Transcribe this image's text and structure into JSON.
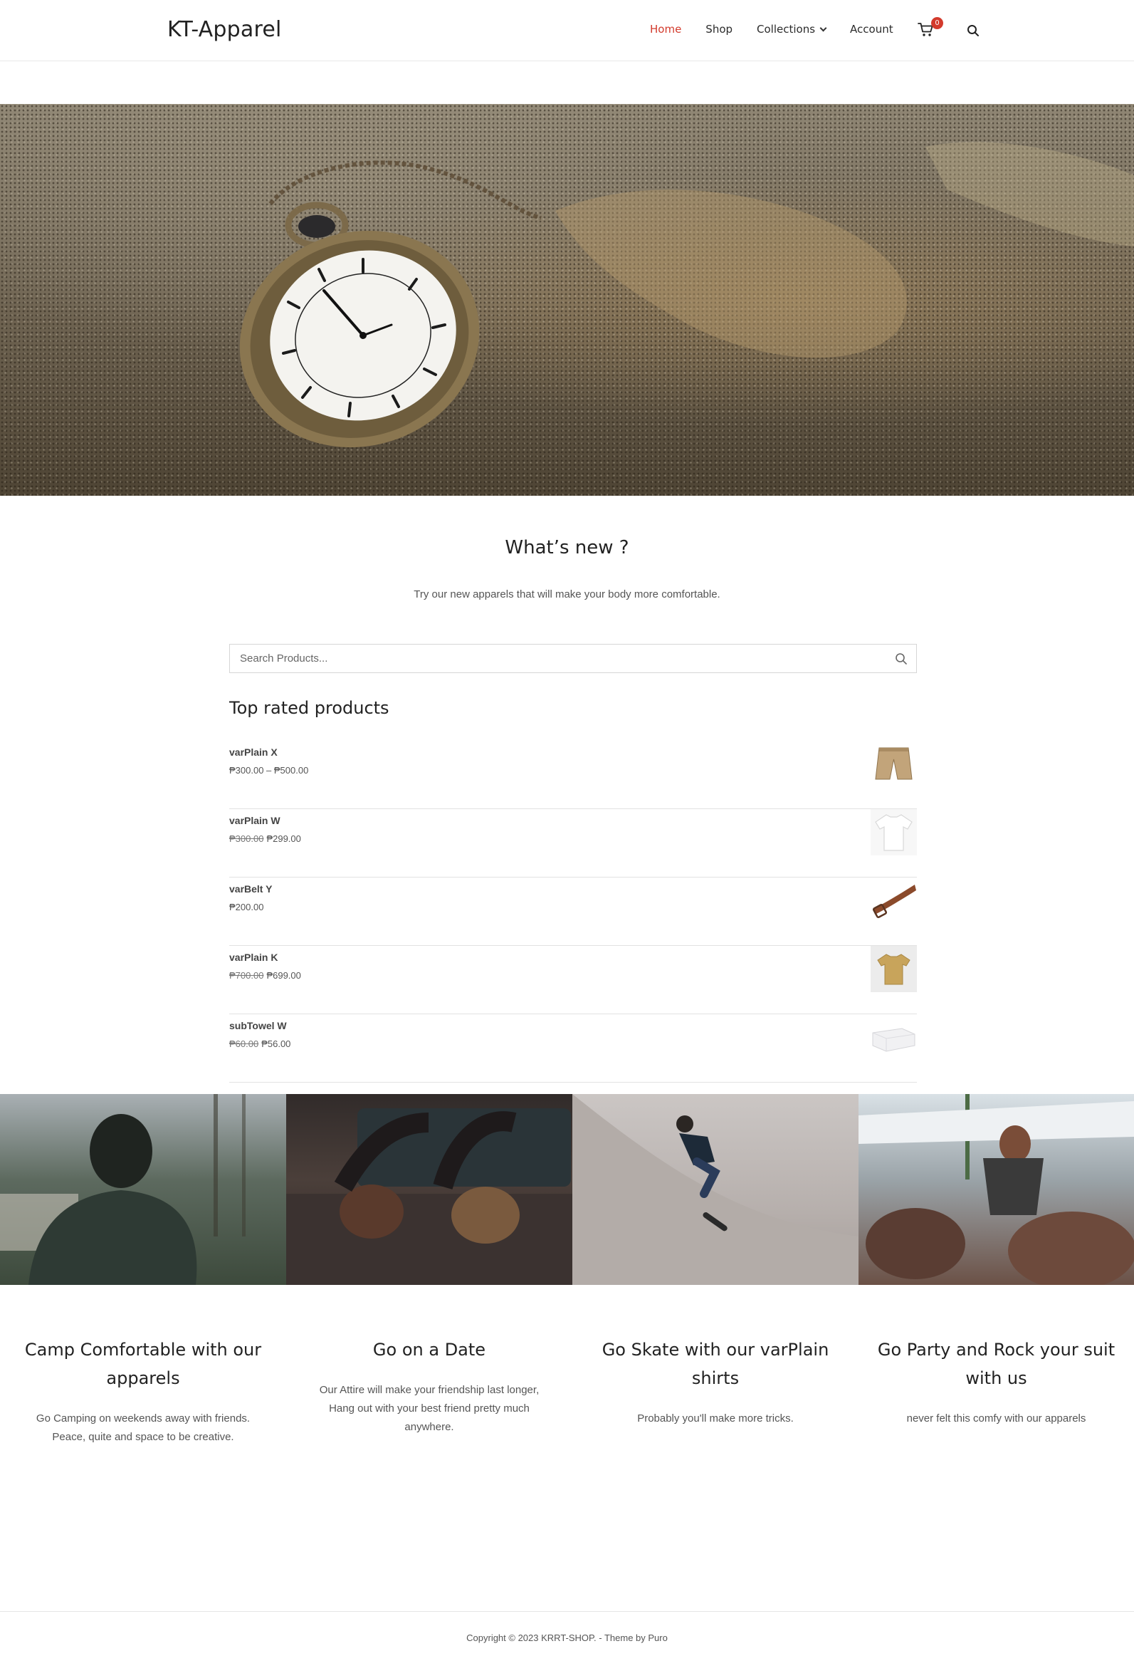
{
  "header": {
    "logo": "KT-Apparel",
    "nav": [
      {
        "label": "Home",
        "active": true
      },
      {
        "label": "Shop",
        "active": false
      },
      {
        "label": "Collections",
        "active": false
      },
      {
        "label": "Account",
        "active": false
      }
    ],
    "cart_count": "0",
    "accent_color": "#d33a2c"
  },
  "whats_new": {
    "title": "What’s new ?",
    "subtitle": "Try our new apparels that will make your body more comfortable."
  },
  "search": {
    "placeholder": "Search Products..."
  },
  "top_rated": {
    "title": "Top rated products",
    "products": [
      {
        "name": "varPlain X",
        "old_price": "",
        "price": "₱300.00 – ₱500.00",
        "thumb": "khaki-shorts"
      },
      {
        "name": "varPlain W",
        "old_price": "₱300.00",
        "price": "₱299.00",
        "thumb": "white-tshirt"
      },
      {
        "name": "varBelt Y",
        "old_price": "",
        "price": "₱200.00",
        "thumb": "brown-belt"
      },
      {
        "name": "varPlain K",
        "old_price": "₱700.00",
        "price": "₱699.00",
        "thumb": "mustard-tshirt"
      },
      {
        "name": "subTowel W",
        "old_price": "₱60.00",
        "price": "₱56.00",
        "thumb": "white-towel"
      }
    ]
  },
  "features": [
    {
      "title": "Camp Comfortable with our apparels",
      "desc": "Go Camping on weekends away with friends. Peace, quite and space to be creative."
    },
    {
      "title": "Go on a Date",
      "desc": "Our Attire will make your friendship last longer, Hang out with your best friend pretty much anywhere."
    },
    {
      "title": "Go Skate with our varPlain shirts",
      "desc": "Probably you'll make more tricks."
    },
    {
      "title": "Go Party and Rock your suit with us",
      "desc": "never felt this comfy with our apparels"
    }
  ],
  "footer": {
    "text": "Copyright © 2023 KRRT-SHOP. - Theme by Puro"
  }
}
